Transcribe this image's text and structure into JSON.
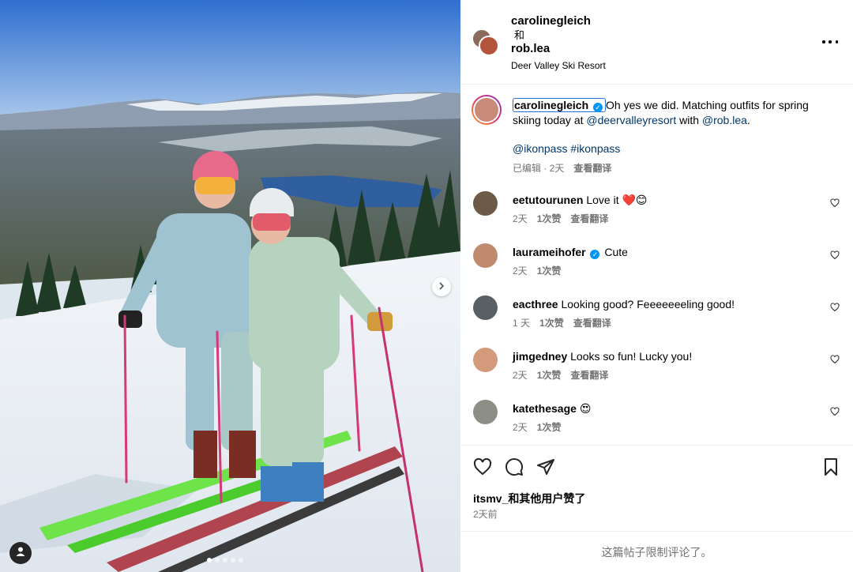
{
  "header": {
    "user1": "carolinegleich",
    "conjunction": "和",
    "user2": "rob.lea",
    "location": "Deer Valley Ski Resort",
    "more_icon": "more-horizontal-icon"
  },
  "caption": {
    "username": "carolinegleich",
    "text_part1": "Oh yes we did. Matching outfits for spring skiing today at ",
    "mention1": "@deervalleyresort",
    "text_part2": " with ",
    "mention2": "@rob.lea",
    "text_part3": ".",
    "hashtags": "@ikonpass #ikonpass",
    "edited": "已编辑 · 2天",
    "translate": "查看翻译"
  },
  "comments": [
    {
      "username": "eetutourunen",
      "text": "Love it ❤️😊",
      "time": "2天",
      "likes": "1次赞",
      "translate": "查看翻译",
      "verified": false
    },
    {
      "username": "laurameihofer",
      "text": "Cute",
      "time": "2天",
      "likes": "1次赞",
      "translate": "",
      "verified": true
    },
    {
      "username": "eacthree",
      "text": "Looking good? Feeeeeeeling good!",
      "time": "1 天",
      "likes": "1次赞",
      "translate": "查看翻译",
      "verified": false
    },
    {
      "username": "jimgedney",
      "text": "Looks so fun! Lucky you!",
      "time": "2天",
      "likes": "1次赞",
      "translate": "查看翻译",
      "verified": false
    },
    {
      "username": "katethesage",
      "text": "😍",
      "time": "2天",
      "likes": "1次赞",
      "translate": "",
      "verified": false
    }
  ],
  "actions": {
    "liked_by": "itsmv_和其他用户赞了",
    "time": "2天前",
    "restricted_notice": "这篇帖子限制评论了。"
  },
  "photo": {
    "carousel_count": 5,
    "carousel_active": 0
  },
  "colors": {
    "link": "#00376b",
    "verified": "#0095f6",
    "meta": "#737373"
  }
}
